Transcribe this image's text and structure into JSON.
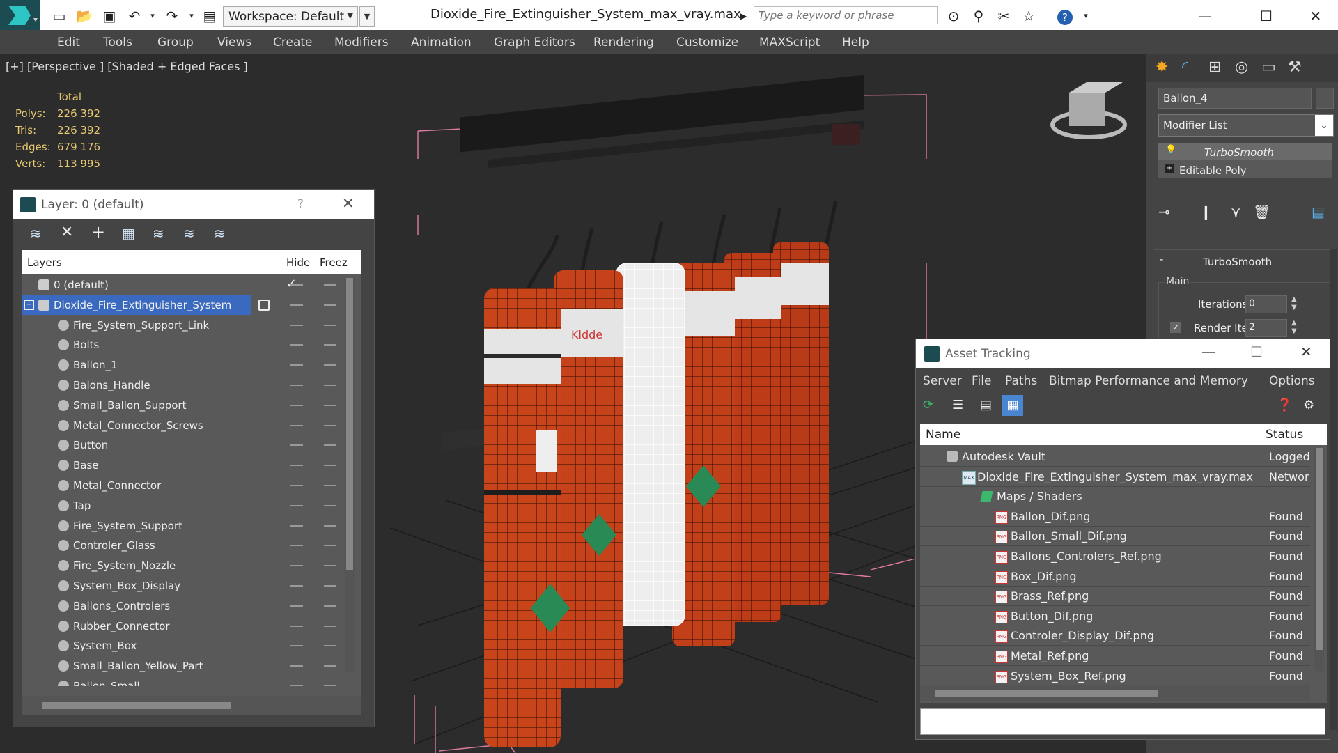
{
  "window": {
    "title": "Dioxide_Fire_Extinguisher_System_max_vray.max",
    "workspace": "Workspace: Default",
    "search_placeholder": "Type a keyword or phrase"
  },
  "menu": [
    "Edit",
    "Tools",
    "Group",
    "Views",
    "Create",
    "Modifiers",
    "Animation",
    "Graph Editors",
    "Rendering",
    "Customize",
    "MAXScript",
    "Help"
  ],
  "viewport": {
    "label": "[+] [Perspective ] [Shaded + Edged Faces ]",
    "stats": {
      "header": "Total",
      "rows": [
        {
          "label": "Polys:",
          "value": "226 392"
        },
        {
          "label": "Tris:",
          "value": "226 392"
        },
        {
          "label": "Edges:",
          "value": "679 176"
        },
        {
          "label": "Verts:",
          "value": "113 995"
        }
      ]
    },
    "brand": "Kidde"
  },
  "layer_panel": {
    "title": "Layer: 0 (default)",
    "help": "?",
    "col_layers": "Layers",
    "col_hide": "Hide",
    "col_freeze": "Freez",
    "rows": [
      {
        "name": "0 (default)",
        "level": 0,
        "type": "layer"
      },
      {
        "name": "Dioxide_Fire_Extinguisher_System",
        "level": 0,
        "type": "layer",
        "selected": true
      },
      {
        "name": "Fire_System_Support_Link",
        "level": 1,
        "type": "object"
      },
      {
        "name": "Bolts",
        "level": 1,
        "type": "object"
      },
      {
        "name": "Ballon_1",
        "level": 1,
        "type": "object"
      },
      {
        "name": "Balons_Handle",
        "level": 1,
        "type": "object"
      },
      {
        "name": "Small_Ballon_Support",
        "level": 1,
        "type": "object"
      },
      {
        "name": "Metal_Connector_Screws",
        "level": 1,
        "type": "object"
      },
      {
        "name": "Button",
        "level": 1,
        "type": "object"
      },
      {
        "name": "Base",
        "level": 1,
        "type": "object"
      },
      {
        "name": "Metal_Connector",
        "level": 1,
        "type": "object"
      },
      {
        "name": "Tap",
        "level": 1,
        "type": "object"
      },
      {
        "name": "Fire_System_Support",
        "level": 1,
        "type": "object"
      },
      {
        "name": "Controler_Glass",
        "level": 1,
        "type": "object"
      },
      {
        "name": "Fire_System_Nozzle",
        "level": 1,
        "type": "object"
      },
      {
        "name": "System_Box_Display",
        "level": 1,
        "type": "object"
      },
      {
        "name": "Ballons_Controlers",
        "level": 1,
        "type": "object"
      },
      {
        "name": "Rubber_Connector",
        "level": 1,
        "type": "object"
      },
      {
        "name": "System_Box",
        "level": 1,
        "type": "object"
      },
      {
        "name": "Small_Ballon_Yellow_Part",
        "level": 1,
        "type": "object"
      },
      {
        "name": "Ballon_Small",
        "level": 1,
        "type": "object"
      }
    ]
  },
  "command_panel": {
    "object_name": "Ballon_4",
    "modifier_list": "Modifier List",
    "stack": [
      "TurboSmooth",
      "Editable Poly"
    ],
    "rollout_title": "TurboSmooth",
    "group_main": "Main",
    "iterations_label": "Iterations:",
    "iterations_value": "0",
    "render_iters_label": "Render Iters:",
    "render_iters_value": "2"
  },
  "asset_tracking": {
    "title": "Asset Tracking",
    "menu": [
      "Server",
      "File",
      "Paths",
      "Bitmap Performance and Memory",
      "Options"
    ],
    "col_name": "Name",
    "col_status": "Status",
    "rows": [
      {
        "name": "Autodesk Vault",
        "status": "Logged",
        "level": 0,
        "icon": "vault"
      },
      {
        "name": "Dioxide_Fire_Extinguisher_System_max_vray.max",
        "status": "Networ",
        "level": 1,
        "icon": "max"
      },
      {
        "name": "Maps / Shaders",
        "status": "",
        "level": 2,
        "icon": "maps"
      },
      {
        "name": "Ballon_Dif.png",
        "status": "Found",
        "level": 3,
        "icon": "png"
      },
      {
        "name": "Ballon_Small_Dif.png",
        "status": "Found",
        "level": 3,
        "icon": "png"
      },
      {
        "name": "Ballons_Controlers_Ref.png",
        "status": "Found",
        "level": 3,
        "icon": "png"
      },
      {
        "name": "Box_Dif.png",
        "status": "Found",
        "level": 3,
        "icon": "png"
      },
      {
        "name": "Brass_Ref.png",
        "status": "Found",
        "level": 3,
        "icon": "png"
      },
      {
        "name": "Button_Dif.png",
        "status": "Found",
        "level": 3,
        "icon": "png"
      },
      {
        "name": "Controler_Display_Dif.png",
        "status": "Found",
        "level": 3,
        "icon": "png"
      },
      {
        "name": "Metal_Ref.png",
        "status": "Found",
        "level": 3,
        "icon": "png"
      },
      {
        "name": "System_Box_Ref.png",
        "status": "Found",
        "level": 3,
        "icon": "png"
      }
    ]
  }
}
